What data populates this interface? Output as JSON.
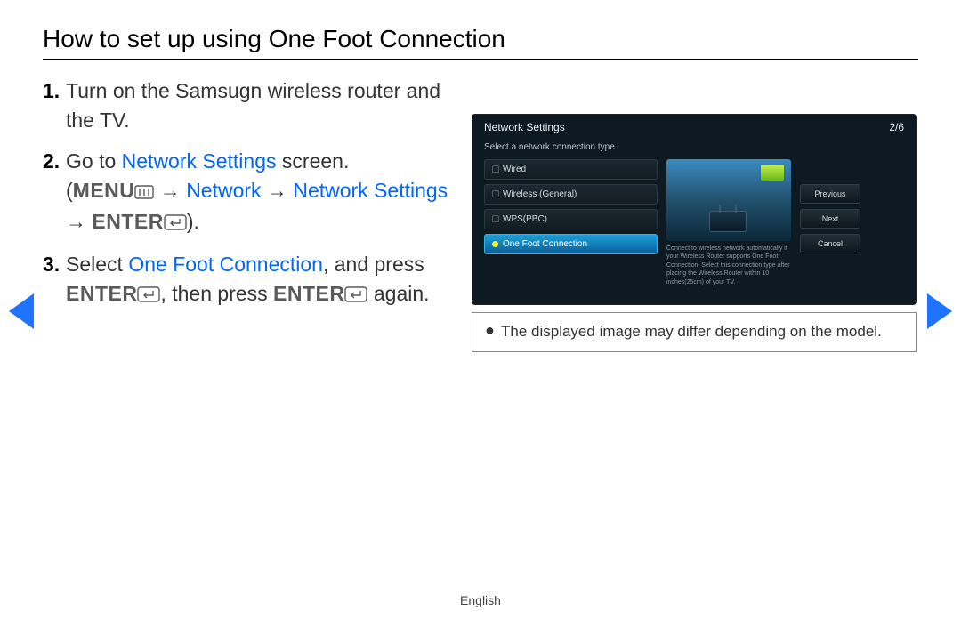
{
  "title": "How to set up using One Foot Connection",
  "steps": {
    "s1": {
      "num": "1.",
      "text": "Turn on the Samsugn wireless router and the TV."
    },
    "s2": {
      "num": "2.",
      "t1": "Go to ",
      "link1": "Network Settings",
      "t2": " screen.",
      "br_open": "(",
      "menu_word": "MENU",
      "arrow1": " → ",
      "link2": "Network",
      "arrow2": " → ",
      "link3": "Network Settings",
      "arrow3": " → ",
      "enter_word": "ENTER",
      "br_close": ")."
    },
    "s3": {
      "num": "3.",
      "t1": "Select ",
      "link1": "One Foot Connection",
      "t2": ", and press ",
      "enter1": "ENTER",
      "t3": ", then press ",
      "enter2": "ENTER",
      "t4": " again."
    }
  },
  "tv": {
    "title": "Network Settings",
    "page": "2/6",
    "subtitle": "Select a network connection type.",
    "items": {
      "i0": "Wired",
      "i1": "Wireless (General)",
      "i2": "WPS(PBC)",
      "i3": "One Foot Connection"
    },
    "desc": "Connect to wireless network automatically if your Wireless Router supports One Foot Connection. Select this connection type after placing the Wireless Router within 10 inches(25cm) of your TV.",
    "buttons": {
      "prev": "Previous",
      "next": "Next",
      "cancel": "Cancel"
    }
  },
  "note": "The displayed image may differ depending on the model.",
  "footer": "English"
}
